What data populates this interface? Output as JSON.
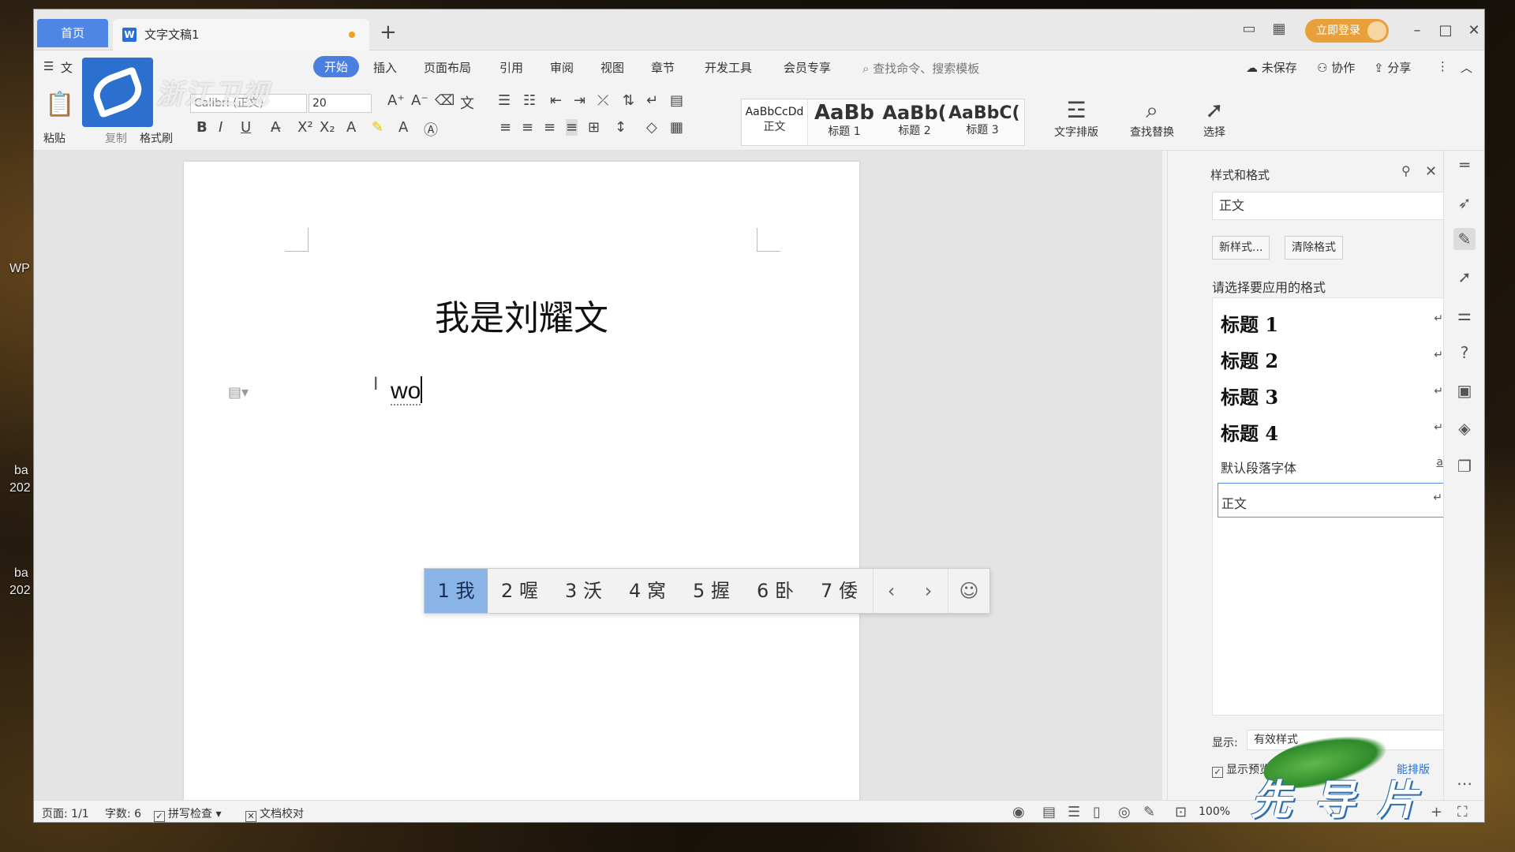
{
  "desktop": {
    "labels": [
      "WP",
      "ba",
      "202",
      "ba",
      "202"
    ]
  },
  "tabs": {
    "home": "首页",
    "doc": "文字文稿1",
    "add": "+"
  },
  "titlebar": {
    "login": "立即登录"
  },
  "menu": {
    "file": "文",
    "items": [
      "开始",
      "插入",
      "页面布局",
      "引用",
      "审阅",
      "视图",
      "章节",
      "开发工具",
      "会员专享"
    ],
    "search_placeholder": "查找命令、搜索模板",
    "unsaved": "未保存",
    "collab": "协作",
    "share": "分享"
  },
  "ribbon": {
    "paste": "粘贴",
    "copy": "复制",
    "format_painter": "格式刷",
    "font_name": "Calibri (正文)",
    "font_size": "20",
    "styles": [
      {
        "sample": "AaBbCcDd",
        "label": "正文"
      },
      {
        "sample": "AaBb",
        "label": "标题 1"
      },
      {
        "sample": "AaBb(",
        "label": "标题 2"
      },
      {
        "sample": "AaBbC(",
        "label": "标题 3"
      }
    ],
    "text_layout": "文字排版",
    "find_replace": "查找替换",
    "select": "选择"
  },
  "overlay": {
    "channel_text": "浙江卫视",
    "program_text": "先导片"
  },
  "document": {
    "title": "我是刘耀文",
    "typed_text": "wo"
  },
  "ime": {
    "candidates": [
      "1 我",
      "2 喔",
      "3 沃",
      "4 窝",
      "5 握",
      "6 卧",
      "7 倭"
    ],
    "prev": "‹",
    "next": "›",
    "emoji": "☺"
  },
  "styles_pane": {
    "title": "样式和格式",
    "current_style": "正文",
    "new_style": "新样式...",
    "clear_format": "清除格式",
    "prompt": "请选择要应用的格式",
    "items": [
      "标题 1",
      "标题 2",
      "标题 3",
      "标题 4",
      "默认段落字体",
      "正文"
    ],
    "show_label": "显示:",
    "show_value": "有效样式",
    "preview_label": "显示预览",
    "smart_layout": "能排版"
  },
  "status": {
    "page": "页面: 1/1",
    "words": "字数: 6",
    "spell_check": "拼写检查",
    "doc_proof": "文档校对",
    "zoom": "100%"
  }
}
